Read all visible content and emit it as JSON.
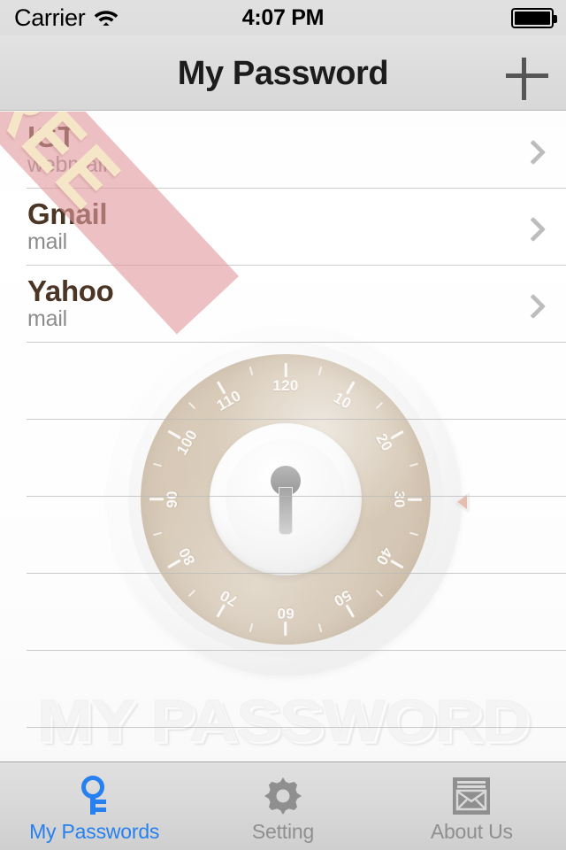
{
  "status_bar": {
    "carrier": "Carrier",
    "wifi_icon": "wifi-icon",
    "time": "4:07 PM",
    "battery_icon": "battery-full-icon"
  },
  "nav_bar": {
    "title": "My Password",
    "add_label": "+",
    "add_icon": "plus-icon"
  },
  "ribbon": {
    "label": "FREE",
    "color": "#e29b9e",
    "text_color": "#f5e6c8"
  },
  "list": {
    "items": [
      {
        "title": "IGT",
        "subtitle": "webmail",
        "chevron": "chevron-right-icon"
      },
      {
        "title": "Gmail",
        "subtitle": "mail",
        "chevron": "chevron-right-icon"
      },
      {
        "title": "Yahoo",
        "subtitle": "mail",
        "chevron": "chevron-right-icon"
      }
    ],
    "empty_row_count": 6,
    "title_color": "#4b3525",
    "subtitle_color": "#8c8c8c"
  },
  "watermark": {
    "wordmark": "MY PASSWORD",
    "dial_icon": "combination-lock-dial-icon",
    "keyhole_icon": "keyhole-icon",
    "dial_numbers": [
      "10",
      "20",
      "30",
      "40",
      "50",
      "60",
      "70",
      "80",
      "90",
      "100",
      "110",
      "120"
    ],
    "dial_face_color": "#d3c4b0"
  },
  "tab_bar": {
    "tabs": [
      {
        "label": "My Passwords",
        "icon": "key-icon",
        "active": true
      },
      {
        "label": "Setting",
        "icon": "gear-icon",
        "active": false
      },
      {
        "label": "About Us",
        "icon": "envelope-icon",
        "active": false
      }
    ],
    "active_color": "#2680ef",
    "inactive_color": "#8f8f8f"
  }
}
